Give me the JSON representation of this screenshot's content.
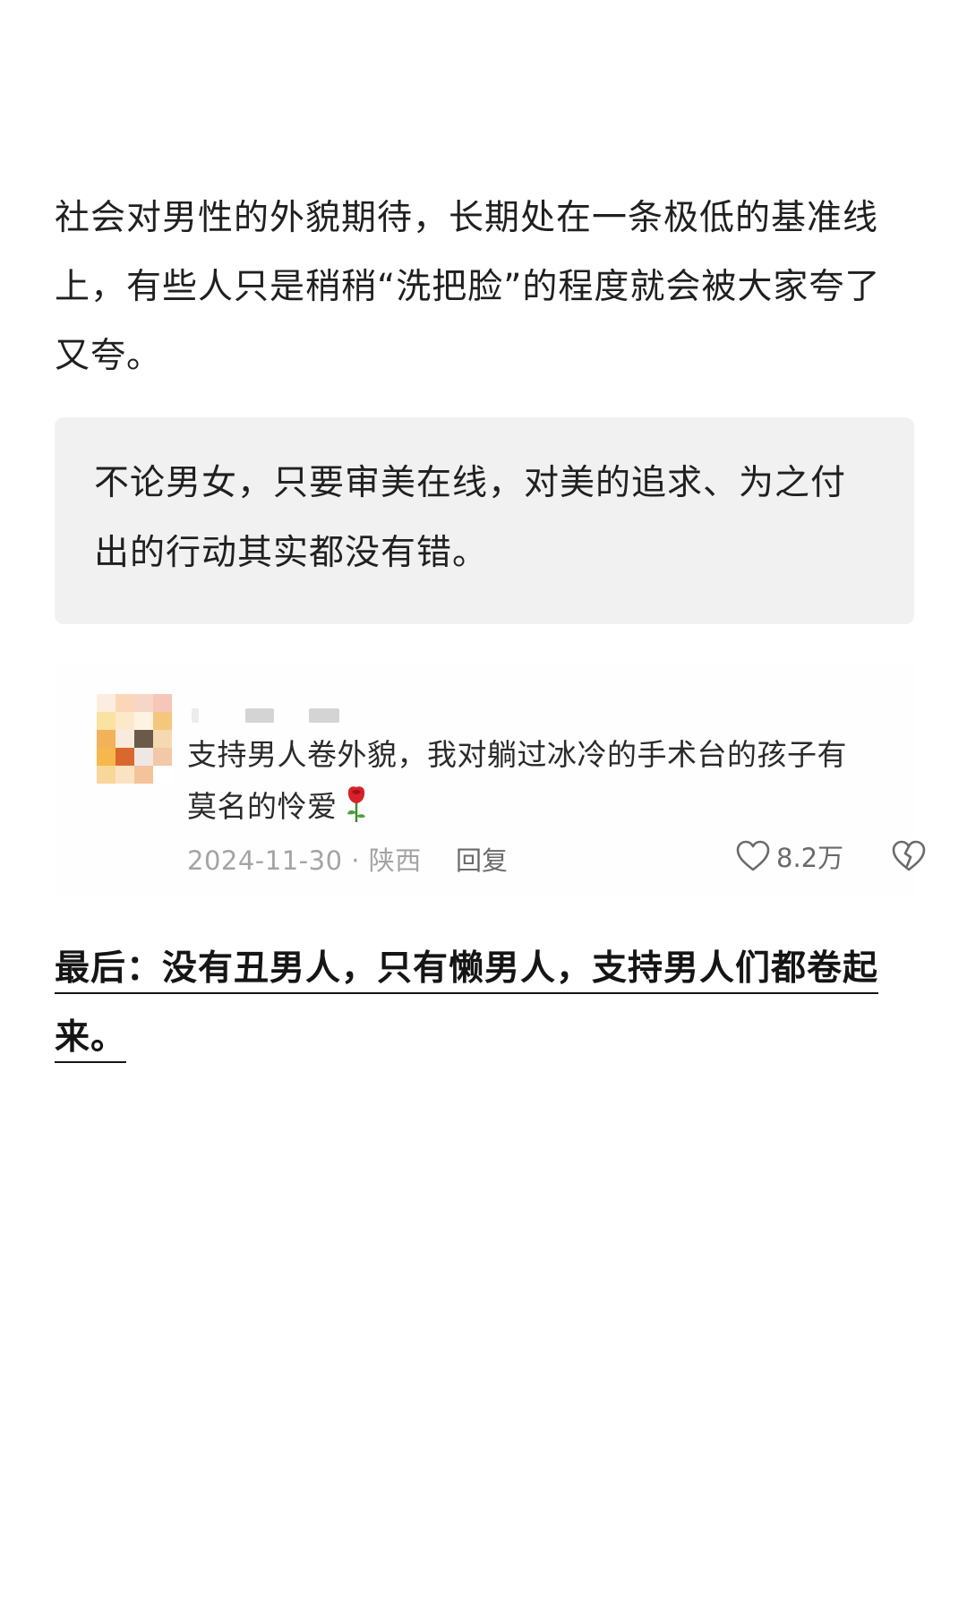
{
  "article": {
    "paragraph_1": "社会对男性的外貌期待，长期处在一条极低的基准线上，有些人只是稍稍“洗把脸”的程度就会被大家夸了又夸。",
    "quote": "不论男女，只要审美在线，对美的追求、为之付出的行动其实都没有错。",
    "closing": "最后：没有丑男人，只有懒男人，支持男人们都卷起来。"
  },
  "comment": {
    "text": "支持男人卷外貌，我对躺过冰冷的手术台的孩子有莫名的怜爱",
    "emoji": "rose-icon",
    "date_location": "2024-11-30 · 陕西",
    "reply_label": "回复",
    "like_count": "8.2万",
    "icons": [
      "heart-icon",
      "broken-heart-icon"
    ]
  },
  "colors": {
    "text": "#202020",
    "quote_background": "#f1f1f1",
    "meta_gray": "#a4a4a4",
    "rose": "#d8222a"
  }
}
